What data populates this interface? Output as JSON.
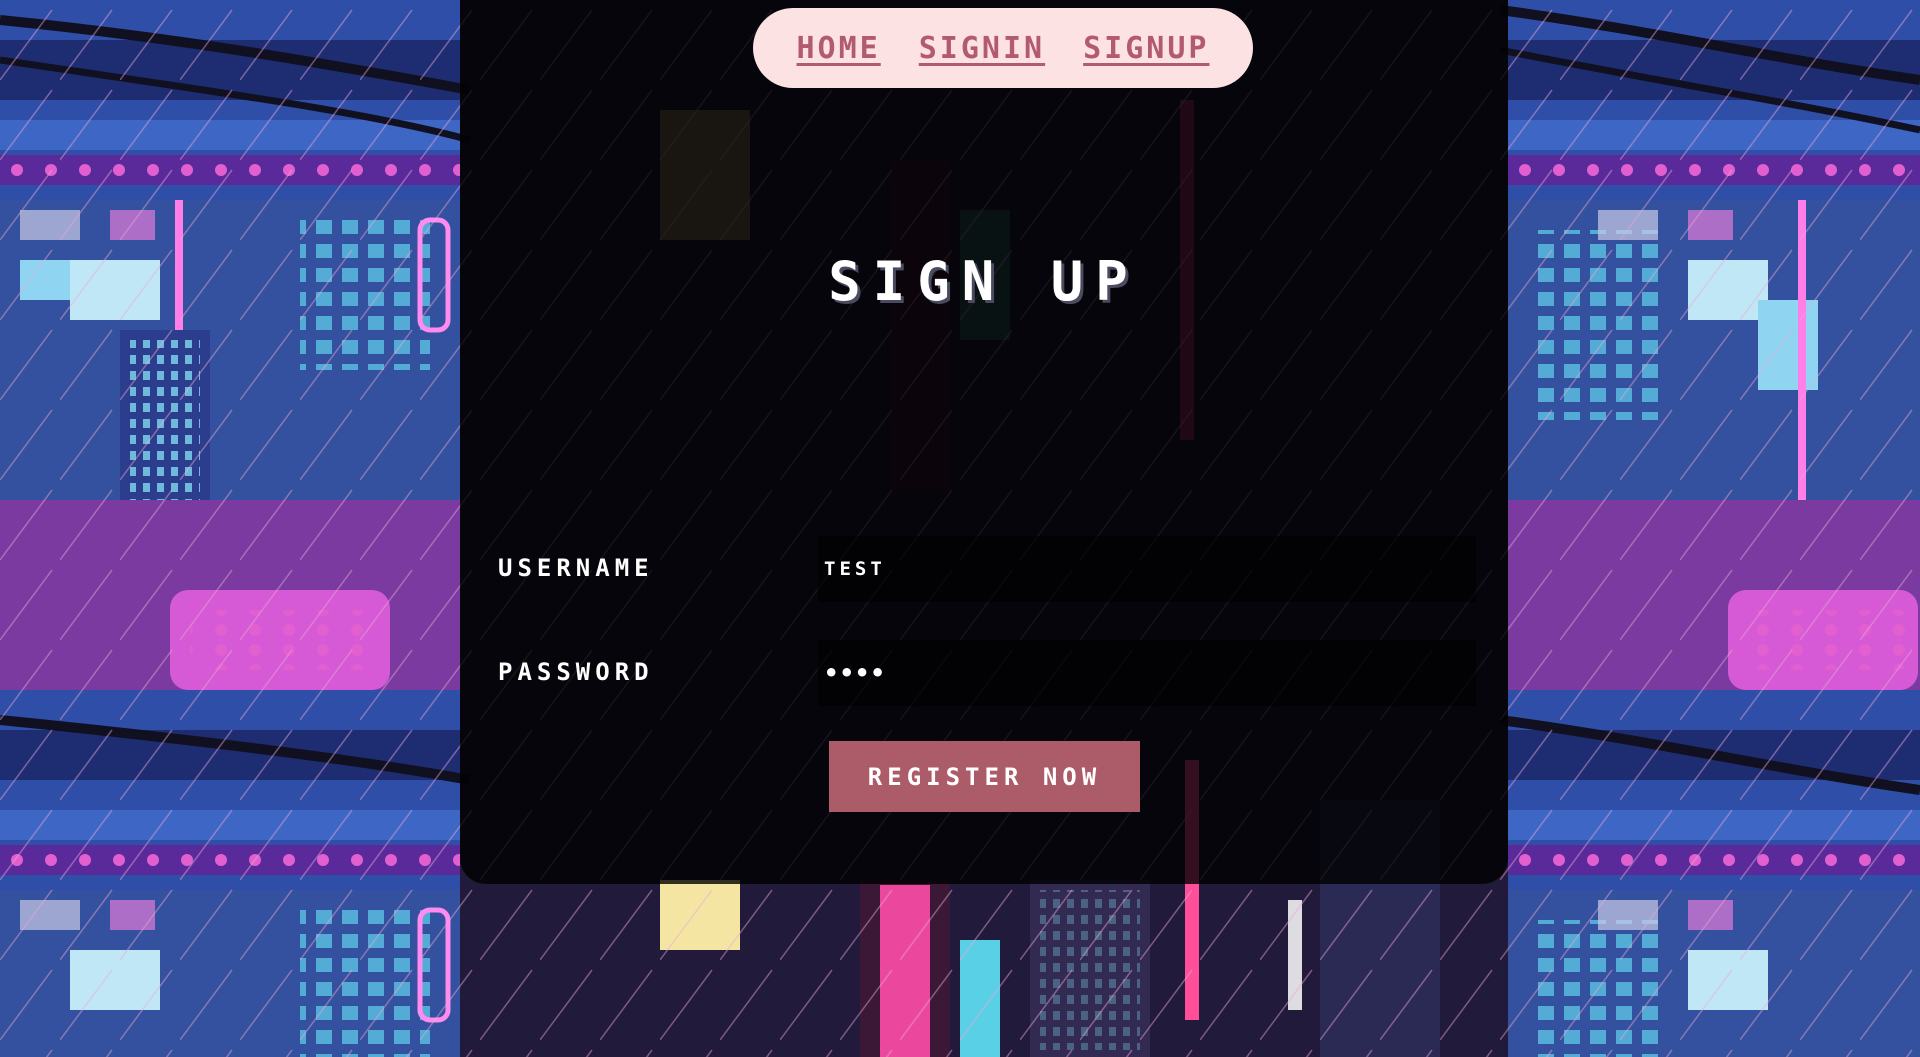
{
  "nav": {
    "items": [
      {
        "label": "HOME"
      },
      {
        "label": "SIGNIN"
      },
      {
        "label": "SIGNUP"
      }
    ]
  },
  "form": {
    "title": "SIGN UP",
    "username": {
      "label": "USERNAME",
      "value": "TEST"
    },
    "password": {
      "label": "PASSWORD",
      "value": "test"
    },
    "submit_label": "REGISTER NOW"
  },
  "colors": {
    "nav_bg": "#fde2e4",
    "nav_link": "#b25b6e",
    "button_bg": "#ac5b68",
    "panel_bg": "#000000"
  }
}
